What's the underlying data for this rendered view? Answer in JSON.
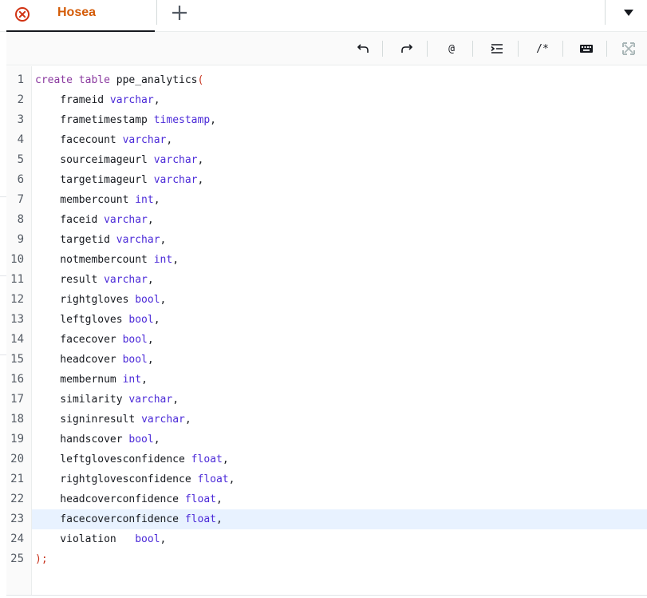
{
  "tab": {
    "label": "Hosea",
    "close_icon": "close-circle-icon",
    "add_icon": "plus-icon",
    "menu_icon": "caret-down-icon"
  },
  "toolbar": {
    "undo_icon": "undo-icon",
    "redo_icon": "redo-icon",
    "at_label": "@",
    "indent_icon": "indent-icon",
    "comment_label": "/*",
    "keyboard_icon": "keyboard-icon",
    "fullscreen_icon": "fullscreen-icon"
  },
  "colors": {
    "accent": "#d45b07",
    "keyword": "#8b3aa0",
    "type": "#4b2ad8",
    "punct": "#c7311b",
    "active_line": "#e8f2ff"
  },
  "editor": {
    "active_line": 23,
    "lines": [
      {
        "n": "1",
        "tokens": [
          {
            "t": "create table",
            "c": "kw"
          },
          {
            "t": " ppe_analytics",
            "c": ""
          },
          {
            "t": "(",
            "c": "pn"
          }
        ]
      },
      {
        "n": "2",
        "tokens": [
          {
            "t": "    frameid ",
            "c": ""
          },
          {
            "t": "varchar",
            "c": "ty"
          },
          {
            "t": ",",
            "c": ""
          }
        ]
      },
      {
        "n": "3",
        "tokens": [
          {
            "t": "    frametimestamp ",
            "c": ""
          },
          {
            "t": "timestamp",
            "c": "ty"
          },
          {
            "t": ",",
            "c": ""
          }
        ]
      },
      {
        "n": "4",
        "tokens": [
          {
            "t": "    facecount ",
            "c": ""
          },
          {
            "t": "varchar",
            "c": "ty"
          },
          {
            "t": ",",
            "c": ""
          }
        ]
      },
      {
        "n": "5",
        "tokens": [
          {
            "t": "    sourceimageurl ",
            "c": ""
          },
          {
            "t": "varchar",
            "c": "ty"
          },
          {
            "t": ",",
            "c": ""
          }
        ]
      },
      {
        "n": "6",
        "tokens": [
          {
            "t": "    targetimageurl ",
            "c": ""
          },
          {
            "t": "varchar",
            "c": "ty"
          },
          {
            "t": ",",
            "c": ""
          }
        ]
      },
      {
        "n": "7",
        "tokens": [
          {
            "t": "    membercount ",
            "c": ""
          },
          {
            "t": "int",
            "c": "ty"
          },
          {
            "t": ",",
            "c": ""
          }
        ]
      },
      {
        "n": "8",
        "tokens": [
          {
            "t": "    faceid ",
            "c": ""
          },
          {
            "t": "varchar",
            "c": "ty"
          },
          {
            "t": ",",
            "c": ""
          }
        ]
      },
      {
        "n": "9",
        "tokens": [
          {
            "t": "    targetid ",
            "c": ""
          },
          {
            "t": "varchar",
            "c": "ty"
          },
          {
            "t": ",",
            "c": ""
          }
        ]
      },
      {
        "n": "10",
        "tokens": [
          {
            "t": "    notmembercount ",
            "c": ""
          },
          {
            "t": "int",
            "c": "ty"
          },
          {
            "t": ",",
            "c": ""
          }
        ]
      },
      {
        "n": "11",
        "tokens": [
          {
            "t": "    result ",
            "c": ""
          },
          {
            "t": "varchar",
            "c": "ty"
          },
          {
            "t": ",",
            "c": ""
          }
        ]
      },
      {
        "n": "12",
        "tokens": [
          {
            "t": "    rightgloves ",
            "c": ""
          },
          {
            "t": "bool",
            "c": "ty"
          },
          {
            "t": ",",
            "c": ""
          }
        ]
      },
      {
        "n": "13",
        "tokens": [
          {
            "t": "    leftgloves ",
            "c": ""
          },
          {
            "t": "bool",
            "c": "ty"
          },
          {
            "t": ",",
            "c": ""
          }
        ]
      },
      {
        "n": "14",
        "tokens": [
          {
            "t": "    facecover ",
            "c": ""
          },
          {
            "t": "bool",
            "c": "ty"
          },
          {
            "t": ",",
            "c": ""
          }
        ]
      },
      {
        "n": "15",
        "tokens": [
          {
            "t": "    headcover ",
            "c": ""
          },
          {
            "t": "bool",
            "c": "ty"
          },
          {
            "t": ",",
            "c": ""
          }
        ]
      },
      {
        "n": "16",
        "tokens": [
          {
            "t": "    membernum ",
            "c": ""
          },
          {
            "t": "int",
            "c": "ty"
          },
          {
            "t": ",",
            "c": ""
          }
        ]
      },
      {
        "n": "17",
        "tokens": [
          {
            "t": "    similarity ",
            "c": ""
          },
          {
            "t": "varchar",
            "c": "ty"
          },
          {
            "t": ",",
            "c": ""
          }
        ]
      },
      {
        "n": "18",
        "tokens": [
          {
            "t": "    signinresult ",
            "c": ""
          },
          {
            "t": "varchar",
            "c": "ty"
          },
          {
            "t": ",",
            "c": ""
          }
        ]
      },
      {
        "n": "19",
        "tokens": [
          {
            "t": "    handscover ",
            "c": ""
          },
          {
            "t": "bool",
            "c": "ty"
          },
          {
            "t": ",",
            "c": ""
          }
        ]
      },
      {
        "n": "20",
        "tokens": [
          {
            "t": "    leftglovesconfidence ",
            "c": ""
          },
          {
            "t": "float",
            "c": "ty"
          },
          {
            "t": ",",
            "c": ""
          }
        ]
      },
      {
        "n": "21",
        "tokens": [
          {
            "t": "    rightglovesconfidence ",
            "c": ""
          },
          {
            "t": "float",
            "c": "ty"
          },
          {
            "t": ",",
            "c": ""
          }
        ]
      },
      {
        "n": "22",
        "tokens": [
          {
            "t": "    headcoverconfidence ",
            "c": ""
          },
          {
            "t": "float",
            "c": "ty"
          },
          {
            "t": ",",
            "c": ""
          }
        ]
      },
      {
        "n": "23",
        "tokens": [
          {
            "t": "    facecoverconfidence ",
            "c": ""
          },
          {
            "t": "float",
            "c": "ty"
          },
          {
            "t": ",",
            "c": ""
          }
        ]
      },
      {
        "n": "24",
        "tokens": [
          {
            "t": "    violation   ",
            "c": ""
          },
          {
            "t": "bool",
            "c": "ty"
          },
          {
            "t": ",",
            "c": ""
          }
        ]
      },
      {
        "n": "25",
        "tokens": [
          {
            "t": ");",
            "c": "pn"
          }
        ]
      }
    ]
  }
}
